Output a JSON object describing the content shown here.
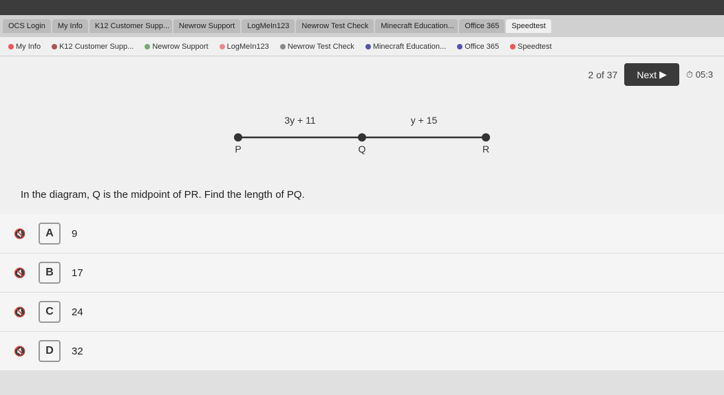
{
  "browser": {
    "tabs": [
      {
        "label": "OCS Login",
        "active": false
      },
      {
        "label": "My Info",
        "active": false
      },
      {
        "label": "K12 Customer Supp...",
        "active": false
      },
      {
        "label": "Newrow Support",
        "active": false
      },
      {
        "label": "LogMeIn123",
        "active": false
      },
      {
        "label": "Newrow Test Check",
        "active": false
      },
      {
        "label": "Minecraft Education...",
        "active": false
      },
      {
        "label": "Office 365",
        "active": false
      },
      {
        "label": "Speedtest",
        "active": true
      }
    ],
    "bookmarks": [
      {
        "label": "My Info",
        "color": "#e55"
      },
      {
        "label": "K12 Customer Supp...",
        "color": "#a55"
      },
      {
        "label": "Newrow Support",
        "color": "#7a7"
      },
      {
        "label": "LogMeIn123",
        "color": "#e88"
      },
      {
        "label": "Newrow Test Check",
        "color": "#888"
      },
      {
        "label": "Minecraft Education...",
        "color": "#55a"
      },
      {
        "label": "Office 365",
        "color": "#55a"
      },
      {
        "label": "Speedtest",
        "color": "#e55"
      }
    ]
  },
  "question_bar": {
    "counter": "2 of 37",
    "next_label": "Next",
    "timer": "05:3"
  },
  "diagram": {
    "segment_pq_label": "3y + 11",
    "segment_qr_label": "y + 15",
    "point_p": "P",
    "point_q": "Q",
    "point_r": "R"
  },
  "question_text": "In the diagram, Q is the midpoint of PR. Find the length of PQ.",
  "answers": [
    {
      "letter": "A",
      "value": "9"
    },
    {
      "letter": "B",
      "value": "17"
    },
    {
      "letter": "C",
      "value": "24"
    },
    {
      "letter": "D",
      "value": "32"
    }
  ],
  "icons": {
    "speaker": "🔇",
    "next_arrow": "▶",
    "timer_icon": "⏱"
  }
}
